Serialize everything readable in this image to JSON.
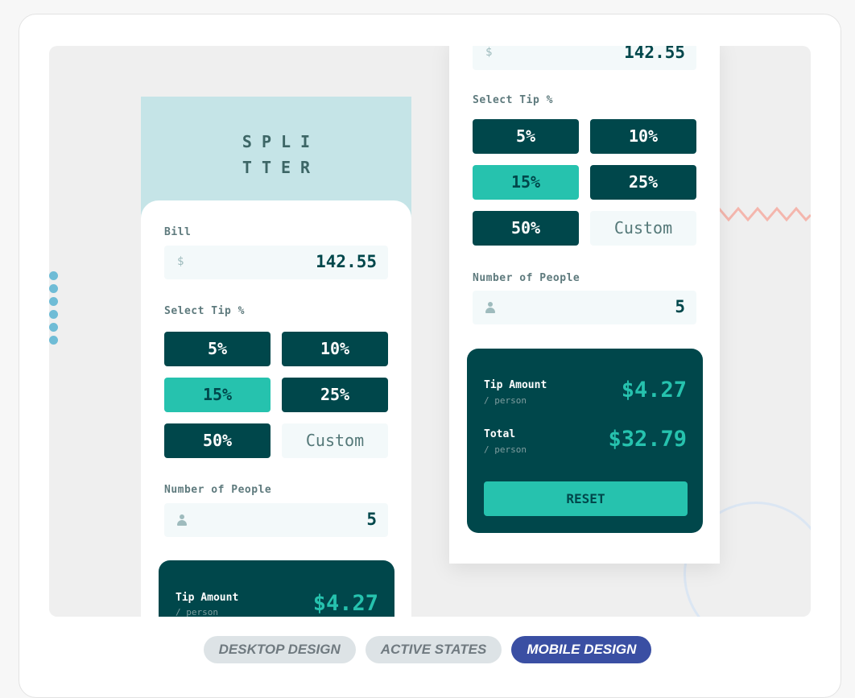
{
  "left_phone": {
    "logo_line1": "SPLI",
    "logo_line2": "TTER",
    "bill_label": "Bill",
    "bill_prefix": "$",
    "bill_value": "142.55",
    "tip_label": "Select Tip %",
    "tips": [
      "5%",
      "10%",
      "15%",
      "25%",
      "50%",
      "Custom"
    ],
    "active_tip": "15%",
    "people_label": "Number of People",
    "people_value": "5",
    "tip_amount_label": "Tip Amount",
    "per_person": "/ person",
    "tip_amount_value": "$4.27"
  },
  "right_phone": {
    "bill_prefix": "$",
    "bill_value": "142.55",
    "tip_label": "Select Tip %",
    "tips": [
      "5%",
      "10%",
      "15%",
      "25%",
      "50%",
      "Custom"
    ],
    "active_tip": "15%",
    "people_label": "Number of People",
    "people_value": "5",
    "tip_amount_label": "Tip Amount",
    "tip_amount_sub": "/ person",
    "tip_amount_value": "$4.27",
    "total_label": "Total",
    "total_sub": "/ person",
    "total_value": "$32.79",
    "reset_label": "RESET"
  },
  "tabs": [
    {
      "label": "DESKTOP DESIGN",
      "selected": false
    },
    {
      "label": "ACTIVE STATES",
      "selected": false
    },
    {
      "label": "MOBILE DESIGN",
      "selected": true
    }
  ],
  "colors": {
    "dark_teal": "#00474b",
    "accent": "#26c2ae",
    "tab_selected": "#3a4fa3"
  }
}
